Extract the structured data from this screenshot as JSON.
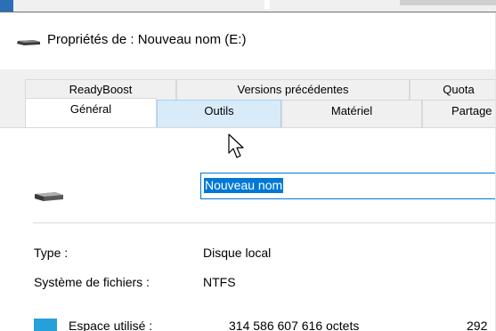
{
  "window": {
    "title": "Propriétés de : Nouveau nom (E:)",
    "title_icon": "drive-icon"
  },
  "tabs": {
    "row1": [
      {
        "label": "ReadyBoost"
      },
      {
        "label": "Versions précédentes"
      },
      {
        "label": "Quota"
      }
    ],
    "row2": [
      {
        "label": "Général",
        "state": "active"
      },
      {
        "label": "Outils",
        "state": "hover"
      },
      {
        "label": "Matériel"
      },
      {
        "label": "Partage"
      }
    ]
  },
  "general": {
    "drive_name_value": "Nouveau nom",
    "type_label": "Type :",
    "type_value": "Disque local",
    "fs_label": "Système de fichiers :",
    "fs_value": "NTFS",
    "used_label": "Espace utilisé :",
    "used_bytes": "314 586 607 616 octets",
    "used_size_partial": "292",
    "used_color": "#26a0da"
  },
  "colors": {
    "accent": "#0078d7",
    "tab_hover": "#d9ebf9",
    "tab_bg": "#f0f0f0"
  }
}
